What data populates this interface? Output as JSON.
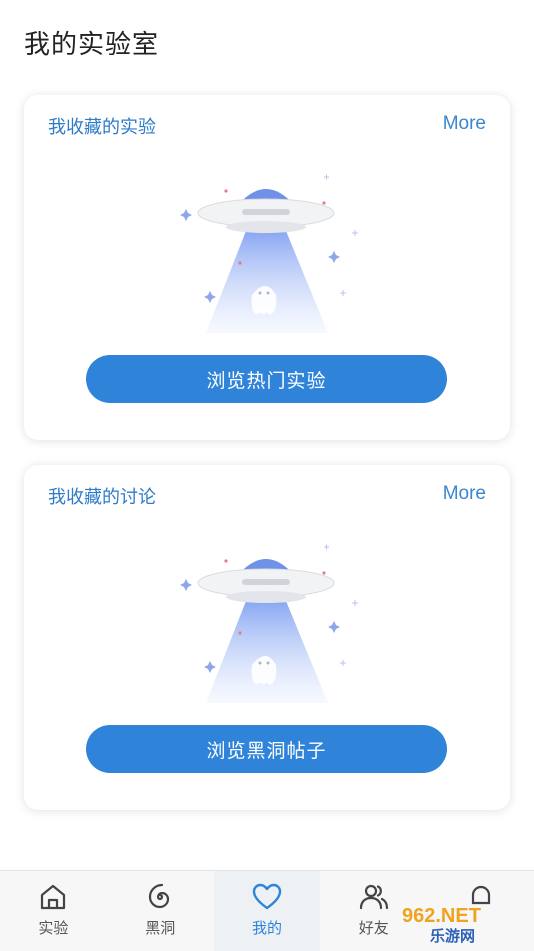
{
  "page": {
    "title": "我的实验室"
  },
  "favorites_experiments": {
    "title": "我收藏的实验",
    "more_label": "More",
    "button_label": "浏览热门实验"
  },
  "favorites_discussions": {
    "title": "我收藏的讨论",
    "more_label": "More",
    "button_label": "浏览黑洞帖子"
  },
  "tabbar": {
    "items": [
      {
        "label": "实验",
        "icon": "home-icon"
      },
      {
        "label": "黑洞",
        "icon": "spiral-icon"
      },
      {
        "label": "我的",
        "icon": "heart-icon",
        "active": true
      },
      {
        "label": "好友",
        "icon": "friends-icon"
      },
      {
        "label": "",
        "icon": "bell-icon"
      }
    ]
  },
  "watermark": {
    "text_top": "962.NET",
    "text_bottom": "乐游网"
  },
  "colors": {
    "accent": "#2f84d9",
    "title_blue": "#2e7bc7"
  }
}
